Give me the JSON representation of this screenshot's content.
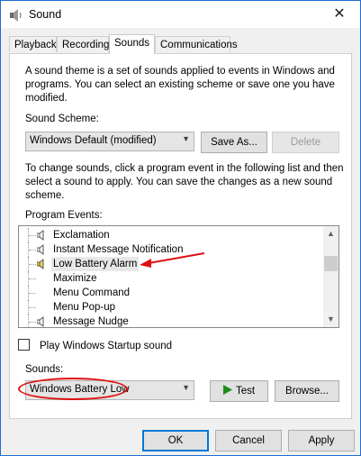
{
  "window": {
    "title": "Sound",
    "close_glyph": "✕"
  },
  "tabs": [
    "Playback",
    "Recording",
    "Sounds",
    "Communications"
  ],
  "active_tab": "Sounds",
  "intro": {
    "line1": "A sound theme is a set of sounds applied to events in Windows and",
    "line2": "programs.  You can select an existing scheme or save one you have",
    "line3": "modified."
  },
  "scheme": {
    "label": "Sound Scheme:",
    "value": "Windows Default (modified)",
    "save_as": "Save As...",
    "delete": "Delete"
  },
  "instructions": {
    "line1": "To change sounds, click a program event in the following list and then",
    "line2": "select a sound to apply.  You can save the changes as a new sound",
    "line3": "scheme."
  },
  "events": {
    "label": "Program Events:",
    "items": [
      {
        "label": "Exclamation",
        "has_sound": true,
        "selected": false
      },
      {
        "label": "Instant Message Notification",
        "has_sound": true,
        "selected": false
      },
      {
        "label": "Low Battery Alarm",
        "has_sound": true,
        "selected": true
      },
      {
        "label": "Maximize",
        "has_sound": false,
        "selected": false
      },
      {
        "label": "Menu Command",
        "has_sound": false,
        "selected": false
      },
      {
        "label": "Menu Pop-up",
        "has_sound": false,
        "selected": false
      },
      {
        "label": "Message Nudge",
        "has_sound": true,
        "selected": false
      }
    ]
  },
  "startup": {
    "label": "Play Windows Startup sound",
    "checked": false
  },
  "sounds": {
    "label": "Sounds:",
    "value": "Windows Battery Low",
    "test": "Test",
    "browse": "Browse..."
  },
  "footer": {
    "ok": "OK",
    "cancel": "Cancel",
    "apply": "Apply"
  },
  "icons": {
    "app": "speaker-icon",
    "event_sound": "speaker-icon",
    "test": "play-triangle-icon",
    "dropdown": "chevron-down-icon"
  },
  "colors": {
    "accent": "#0078d7",
    "annotation": "#e01010",
    "play_green": "#1a8f1a",
    "speaker_active": "#e8d84a"
  }
}
